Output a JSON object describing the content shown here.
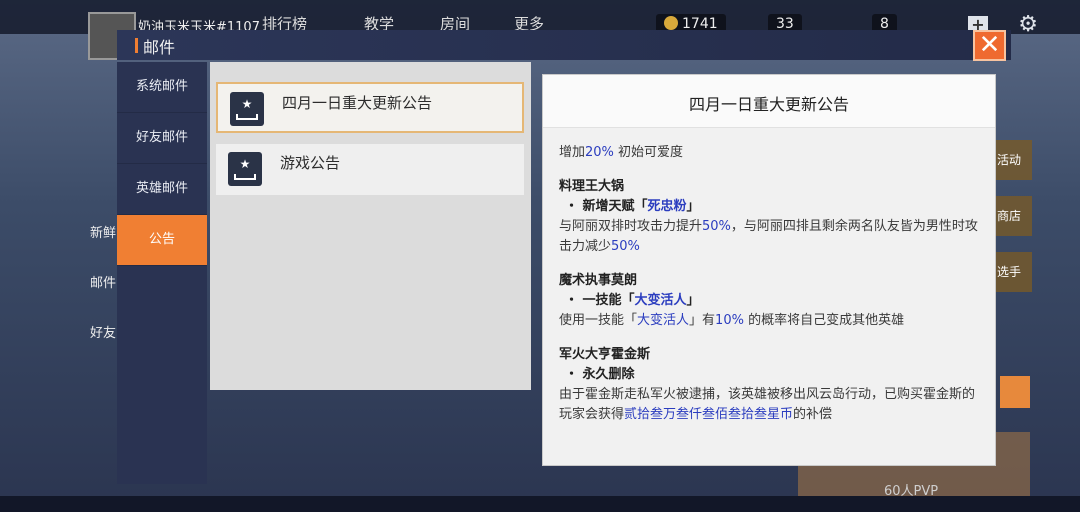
{
  "background": {
    "player_name": "奶油玉米玉米#1107",
    "nav": [
      "排行榜",
      "教学",
      "房间",
      "更多"
    ],
    "resources": [
      "1741",
      "33",
      "8"
    ],
    "side_left": [
      "新鲜",
      "邮件",
      "好友"
    ],
    "side_right": [
      "活动",
      "商店",
      "选手"
    ],
    "pvp_label": "60人PVP"
  },
  "dialog": {
    "title": "邮件",
    "close_symbol": "✕"
  },
  "sidebar": {
    "items": [
      {
        "label": "系统邮件"
      },
      {
        "label": "好友邮件"
      },
      {
        "label": "英雄邮件"
      },
      {
        "label": "公告"
      }
    ],
    "active_index": 3
  },
  "mail_list": [
    {
      "title": "四月一日重大更新公告",
      "icon": "mailbox-star-icon",
      "selected": true
    },
    {
      "title": "游戏公告",
      "icon": "mailbox-star-icon",
      "selected": false
    }
  ],
  "content": {
    "title": "四月一日重大更新公告",
    "intro_pre": "增加",
    "intro_value": "20%",
    "intro_post": " 初始可爱度",
    "sections": [
      {
        "name": "料理王大锅",
        "bullet_pre": "・ 新增天赋「",
        "bullet_hl": "死忠粉",
        "bullet_post": "」",
        "desc1_pre": "与阿丽双排时攻击力提升",
        "desc1_hl": "50%",
        "desc1_post": "，与阿丽四排且剩余两名队友皆为男性时攻击力减少",
        "desc1_hl2": "50%"
      },
      {
        "name": "魔术执事莫朗",
        "bullet_pre": "・ 一技能「",
        "bullet_hl": "大变活人",
        "bullet_post": "」",
        "desc1_pre": "使用一技能「",
        "desc1_hl": "大变活人",
        "desc1_mid": "」有",
        "desc1_hl2": "10%",
        "desc1_post": " 的概率将自己变成其他英雄"
      },
      {
        "name": "军火大亨霍金斯",
        "bullet": "・ 永久删除",
        "desc1_pre": "由于霍金斯走私军火被逮捕，该英雄被移出风云岛行动，已购买霍金斯的玩家会获得",
        "desc1_hl": "贰拾叁万叁仟叁佰叁拾叁星币",
        "desc1_post": "的补偿"
      }
    ]
  },
  "colors": {
    "accent": "#f07f33",
    "highlight": "#2b3dbf",
    "sidebar_bg": "#2a3352"
  }
}
